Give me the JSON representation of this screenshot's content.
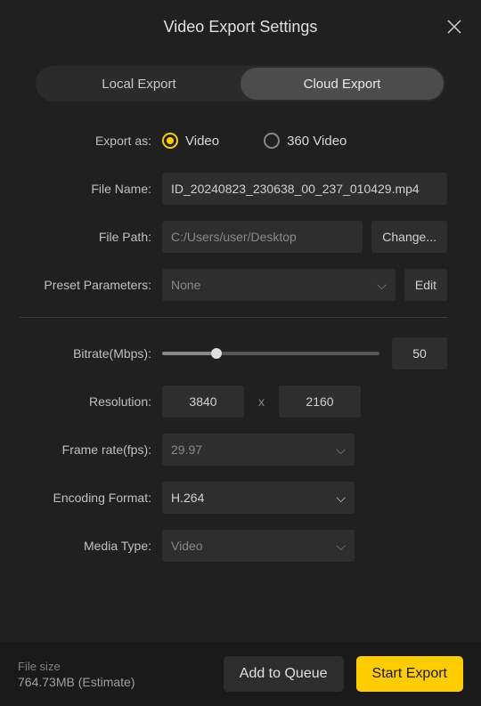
{
  "title": "Video Export Settings",
  "tabs": {
    "local": "Local Export",
    "cloud": "Cloud Export",
    "active": "cloud"
  },
  "labels": {
    "export_as": "Export as:",
    "file_name": "File Name:",
    "file_path": "File Path:",
    "preset": "Preset Parameters:",
    "bitrate": "Bitrate(Mbps):",
    "resolution": "Resolution:",
    "frame_rate": "Frame rate(fps):",
    "encoding": "Encoding Format:",
    "media_type": "Media Type:"
  },
  "export_as": {
    "video": "Video",
    "video_360": "360 Video",
    "selected": "video"
  },
  "file_name": "ID_20240823_230638_00_237_010429.mp4",
  "file_path": "C:/Users/user/Desktop",
  "change_btn": "Change...",
  "preset": {
    "value": "None",
    "edit_btn": "Edit"
  },
  "bitrate": {
    "value": "50",
    "percent": 25
  },
  "resolution": {
    "w": "3840",
    "h": "2160",
    "sep": "x"
  },
  "frame_rate": "29.97",
  "encoding": "H.264",
  "media_type": "Video",
  "footer": {
    "size_label": "File size",
    "size_value": "764.73MB (Estimate)",
    "queue_btn": "Add to Queue",
    "export_btn": "Start Export"
  }
}
